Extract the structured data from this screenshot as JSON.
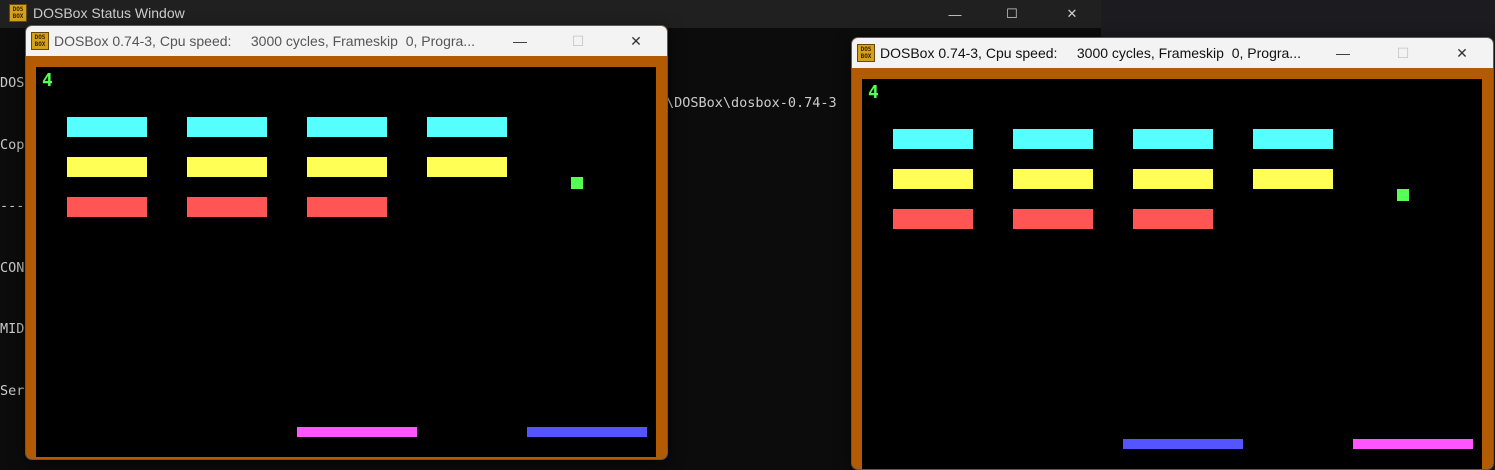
{
  "status_window": {
    "title": "DOSBox Status Window",
    "console_lines": [
      "DOS",
      "Cop",
      "---",
      "",
      "CON",
      "MID",
      "Ser"
    ],
    "console_right": "\\DOSBox\\dosbox-0.74-3",
    "minimize": "—",
    "maximize": "☐",
    "close": "✕"
  },
  "dosbox_left": {
    "title": "DOSBox 0.74-3, Cpu speed:     3000 cycles, Frameskip  0, Progra...",
    "icon_text": "DOS BOX",
    "score": "4",
    "minimize": "—",
    "maximize": "☐",
    "close": "✕"
  },
  "dosbox_right": {
    "title": "DOSBox 0.74-3, Cpu speed:     3000 cycles, Frameskip  0, Progra...",
    "icon_text": "DOS BOX",
    "score": "4",
    "minimize": "—",
    "maximize": "☐",
    "close": "✕"
  },
  "colors": {
    "border": "#b35a05",
    "brick_cyan": "#55ffff",
    "brick_yellow": "#ffff55",
    "brick_red": "#ff5555",
    "ball": "#55ff55",
    "paddle_pink": "#ff55ff",
    "paddle_blue": "#5555ff"
  }
}
